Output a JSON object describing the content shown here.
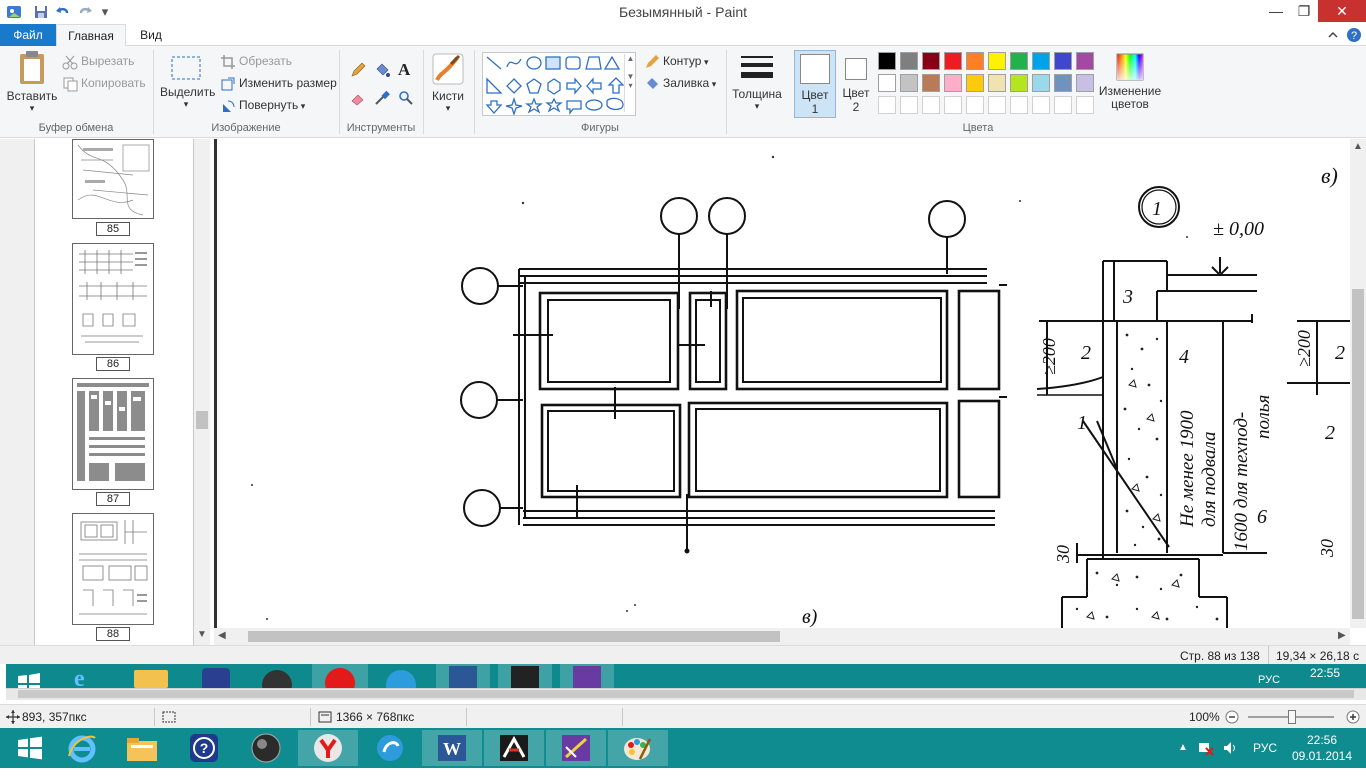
{
  "window": {
    "title": "Безымянный - Paint",
    "min_glyph": "—",
    "max_glyph": "❐",
    "close_glyph": "✕"
  },
  "tabs": {
    "file": "Файл",
    "home": "Главная",
    "view": "Вид"
  },
  "ribbon": {
    "clipboard": {
      "paste": "Вставить",
      "cut": "Вырезать",
      "copy": "Копировать",
      "group": "Буфер обмена"
    },
    "image": {
      "select": "Выделить",
      "crop": "Обрезать",
      "resize": "Изменить размер",
      "rotate": "Повернуть",
      "group": "Изображение"
    },
    "tools": {
      "group": "Инструменты",
      "text_glyph": "A"
    },
    "brushes": {
      "label": "Кисти"
    },
    "shapes": {
      "outline": "Контур",
      "fill": "Заливка",
      "group": "Фигуры"
    },
    "size": {
      "label": "Толщина"
    },
    "color1": {
      "label": "Цвет",
      "num": "1"
    },
    "color2": {
      "label": "Цвет",
      "num": "2"
    },
    "colors": {
      "group": "Цвета",
      "edit": "Изменение цветов",
      "row1": [
        "#000000",
        "#7f7f7f",
        "#880015",
        "#ed1c24",
        "#ff7f27",
        "#fff200",
        "#22b14c",
        "#00a2e8",
        "#3f48cc",
        "#a349a4"
      ],
      "row2": [
        "#ffffff",
        "#c3c3c3",
        "#b97a57",
        "#ffaec9",
        "#ffc90e",
        "#efe4b0",
        "#b5e61d",
        "#99d9ea",
        "#7092be",
        "#c8bfe7"
      ]
    }
  },
  "thumbnails": {
    "pages": [
      {
        "num": "85"
      },
      {
        "num": "86"
      },
      {
        "num": "87"
      },
      {
        "num": "88"
      }
    ]
  },
  "canvas": {
    "labels": {
      "v_top": "в)",
      "v_bottom": "в)",
      "circle_one": "1",
      "zero": "± 0,00",
      "n3": "3",
      "n2": "2",
      "n4": "4",
      "n1": "1",
      "n6": "6",
      "n200": "≥200",
      "n200b": "≥200",
      "n2b": "2",
      "n2c": "2",
      "n30": "30",
      "n30b": "30",
      "vert1": "Не менее 1900",
      "vert2": "для подвала",
      "vert3": "1600 для техпод-",
      "vert4": "полья"
    }
  },
  "inner_status": {
    "page": "Стр. 88 из 138",
    "size": "19,34 × 26,18 с"
  },
  "inner_taskbar": {
    "lang": "РУС",
    "time": "22:55"
  },
  "status": {
    "cursor": "893, 357пкс",
    "dimensions": "1366 × 768пкс",
    "zoom": "100%"
  },
  "taskbar": {
    "lang": "РУС",
    "time": "22:56",
    "date": "09.01.2014"
  }
}
